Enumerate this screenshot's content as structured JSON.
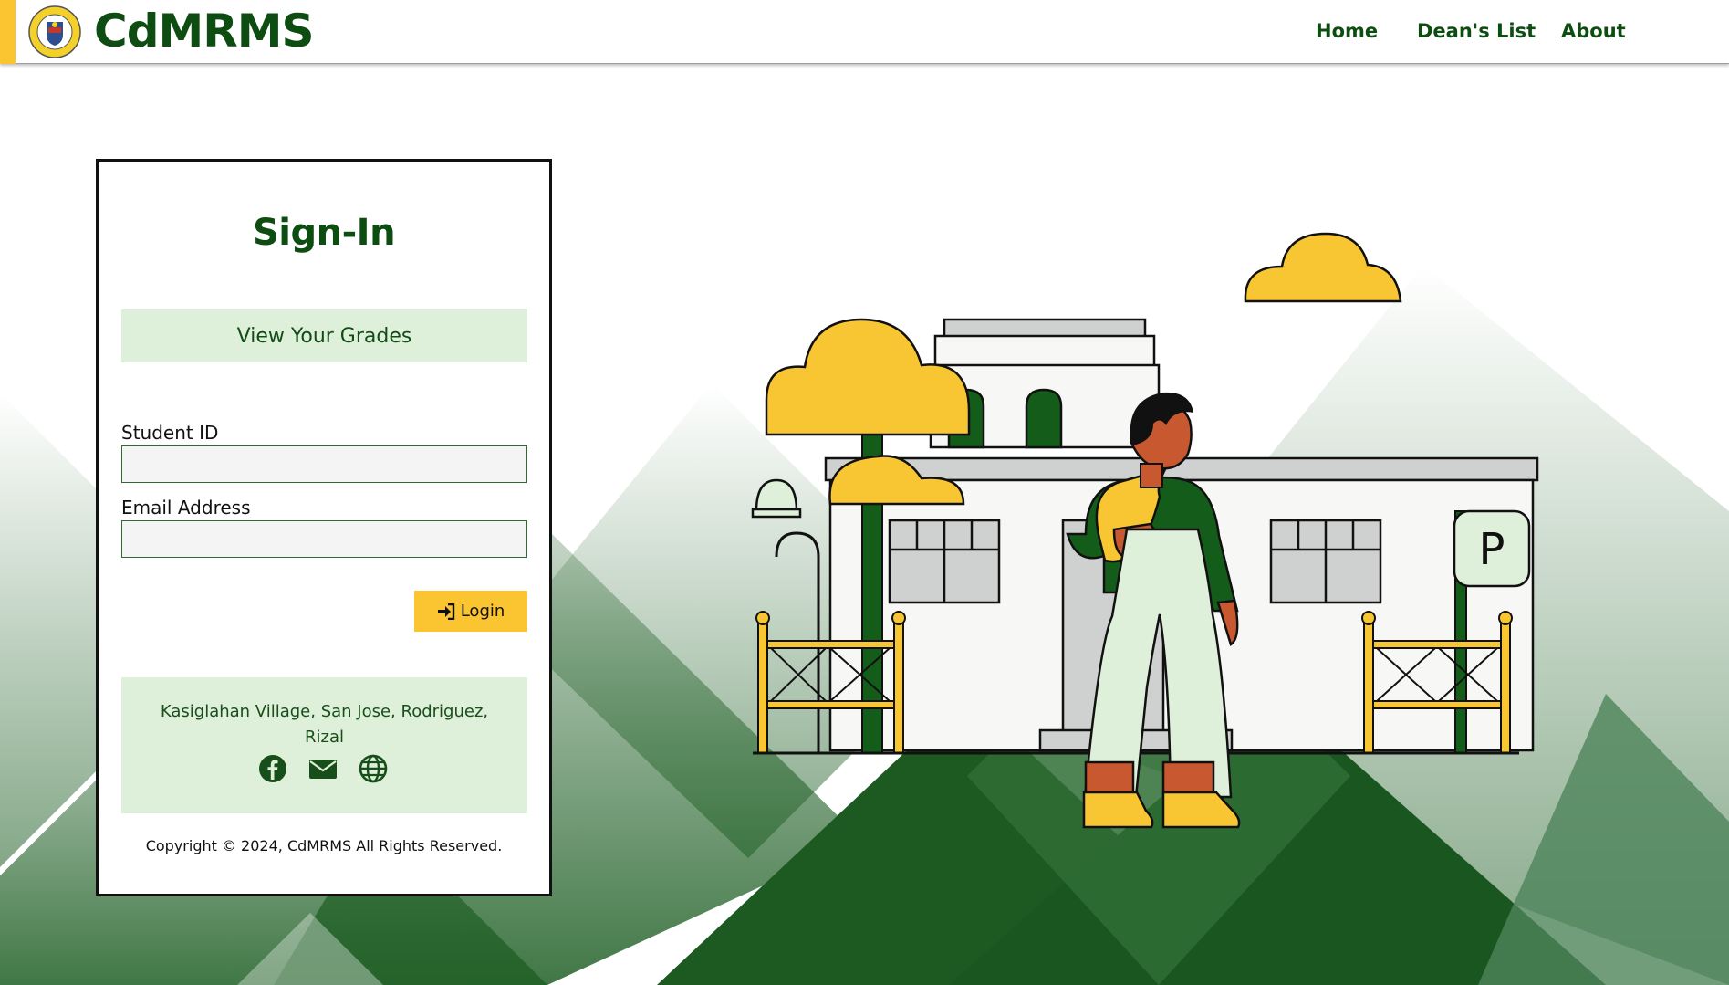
{
  "header": {
    "brand": "CdMRMS",
    "nav": [
      {
        "label": "Home"
      },
      {
        "label": "Dean's List"
      },
      {
        "label": "About"
      }
    ]
  },
  "signin": {
    "title": "Sign-In",
    "view_grades_label": "View Your Grades",
    "student_id_label": "Student ID",
    "student_id_value": "",
    "email_label": "Email Address",
    "email_value": "",
    "login_label": "Login"
  },
  "footer": {
    "address": "Kasiglahan Village, San Jose, Rodriguez, Rizal",
    "socials": [
      {
        "icon": "facebook-icon"
      },
      {
        "icon": "envelope-icon"
      },
      {
        "icon": "globe-icon"
      }
    ],
    "copyright": "Copyright © 2024, CdMRMS All Rights Reserved."
  },
  "colors": {
    "brand_green": "#0e4d12",
    "accent_yellow": "#fbc531",
    "light_green": "#dff0da"
  }
}
